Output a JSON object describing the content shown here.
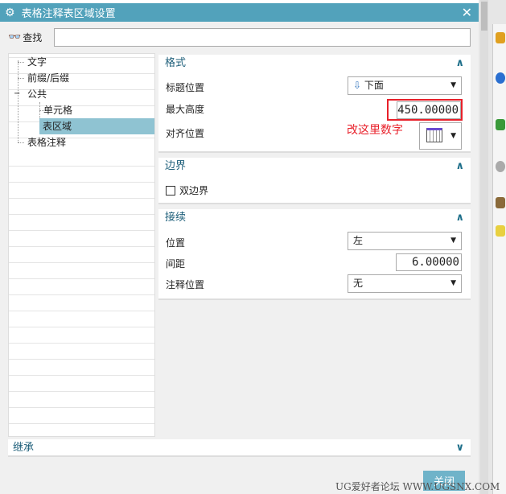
{
  "dialog": {
    "title": "表格注释表区域设置",
    "close_label": "关闭",
    "watermark": "UG爱好者论坛 WWW.UGSNX.COM"
  },
  "search": {
    "label": "查找",
    "value": ""
  },
  "tree": {
    "items": [
      {
        "label": "文字"
      },
      {
        "label": "前缀/后缀"
      },
      {
        "label": "公共"
      },
      {
        "label": "单元格"
      },
      {
        "label": "表区域",
        "selected": true
      },
      {
        "label": "表格注释"
      }
    ]
  },
  "format": {
    "title": "格式",
    "title_pos_label": "标题位置",
    "title_pos_value": "下面",
    "max_height_label": "最大高度",
    "max_height_value": "450.00000",
    "align_label": "对齐位置",
    "annotation": "改这里数字"
  },
  "border": {
    "title": "边界",
    "double_label": "双边界",
    "double_checked": false
  },
  "continue": {
    "title": "接续",
    "position_label": "位置",
    "position_value": "左",
    "spacing_label": "间距",
    "spacing_value": "6.00000",
    "note_pos_label": "注释位置",
    "note_pos_value": "无"
  },
  "inherit": {
    "title": "继承"
  },
  "colors": {
    "titlebar": "#52a2bb",
    "selected": "#8fc3d2",
    "annotation": "#e8202a"
  }
}
